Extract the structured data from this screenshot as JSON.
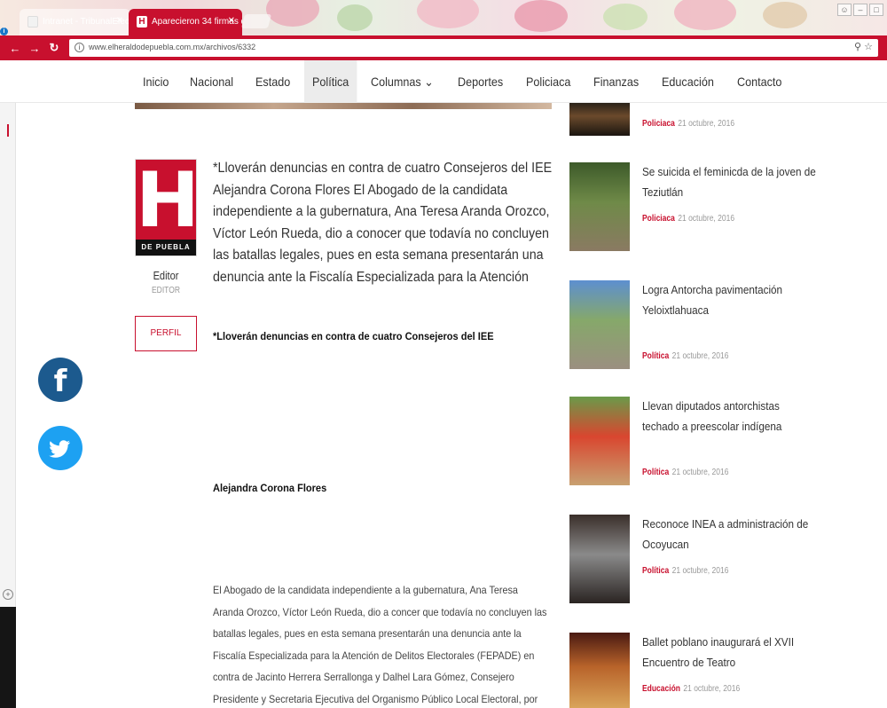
{
  "browser": {
    "tabs": [
      {
        "label": "Intranet - TribunalElect",
        "active": false
      },
      {
        "label": "Aparecieron 34 firmas d",
        "active": true
      }
    ],
    "url": "www.elheraldodepuebla.com.mx/archivos/6332",
    "tab2_favicon": "H"
  },
  "nav": {
    "items": [
      "Inicio",
      "Nacional",
      "Estado",
      "Política",
      "Columnas ⌄",
      "Deportes",
      "Policiaca",
      "Finanzas",
      "Educación",
      "Contacto"
    ],
    "active": "Política"
  },
  "author": {
    "logo_letter": "H",
    "logo_band": "DE PUEBLA",
    "name": "Editor",
    "role": "EDITOR",
    "profile_button": "PERFIL"
  },
  "article": {
    "lead": "*Lloverán denuncias en contra de cuatro Consejeros del IEE Alejandra Corona Flores El Abogado de la candidata independiente a la gubernatura, Ana Teresa Aranda Orozco, Víctor León Rueda, dio a conocer que todavía no concluyen las batallas legales, pues en esta semana presentarán una denuncia ante la Fiscalía Especializada para la Atención",
    "bold_line": "*Lloverán denuncias en contra de cuatro Consejeros del IEE",
    "author_line": "Alejandra Corona Flores",
    "body": "El Abogado de la candidata independiente a la gubernatura, Ana Teresa Aranda Orozco, Víctor León Rueda, dio a concer que todavía no concluyen las batallas legales, pues en esta semana presentarán una denuncia ante la Fiscalía Especializada para la Atención de Delitos Electorales (FEPADE) en contra de Jacinto Herrera Serrallonga y Dalhel Lara Gómez, Consejero Presidente y Secretaria Ejecutiva del Organismo Público Local Electoral, por"
  },
  "sidebar": [
    {
      "title": "",
      "category": "Policiaca",
      "date": "21 octubre, 2016"
    },
    {
      "title": "Se suicida el feminicda de la joven de Teziutlán",
      "category": "Policiaca",
      "date": "21 octubre, 2016"
    },
    {
      "title": "Logra Antorcha pavimentación Yeloixtlahuaca",
      "category": "Política",
      "date": "21 octubre, 2016"
    },
    {
      "title": "Llevan diputados antorchistas techado a preescolar indígena",
      "category": "Política",
      "date": "21 octubre, 2016"
    },
    {
      "title": "Reconoce INEA a administración de Ocoyucan",
      "category": "Política",
      "date": "21 octubre, 2016"
    },
    {
      "title": "Ballet poblano inaugurará el XVII Encuentro de Teatro",
      "category": "Educación",
      "date": "21 octubre, 2016"
    }
  ],
  "social": {
    "facebook_glyph": "f"
  },
  "colors": {
    "brand_red": "#c8102e",
    "facebook": "#1c5a8e",
    "twitter": "#1da1f2"
  }
}
